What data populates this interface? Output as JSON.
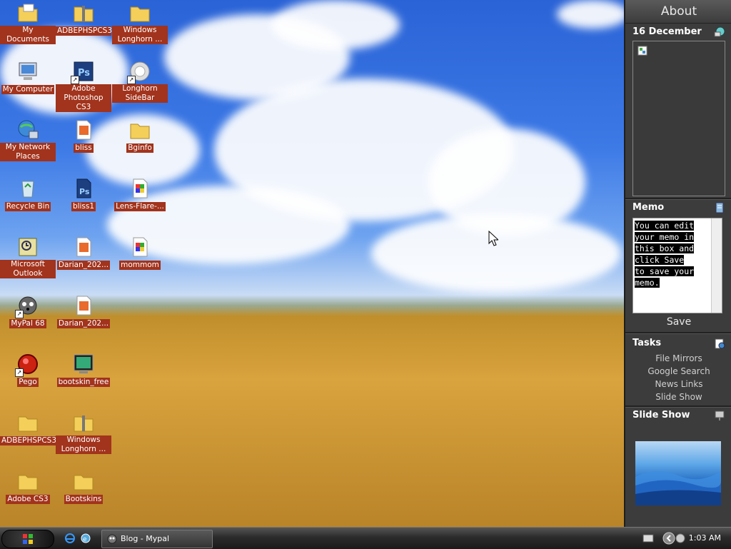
{
  "desktop": {
    "icons": [
      {
        "label": "My Documents",
        "icon": "folder-icon"
      },
      {
        "label": "ADBEPHSPCS3",
        "icon": "zip-folder-icon"
      },
      {
        "label": "Windows Longhorn ...",
        "icon": "folder-icon"
      },
      {
        "label": "My Computer",
        "icon": "computer-icon"
      },
      {
        "label": "Adobe Photoshop CS3",
        "icon": "photoshop-icon"
      },
      {
        "label": "Longhorn SideBar",
        "icon": "sidebar-icon"
      },
      {
        "label": "My Network Places",
        "icon": "network-icon"
      },
      {
        "label": "bliss",
        "icon": "image-file-icon"
      },
      {
        "label": "Bginfo",
        "icon": "folder-icon"
      },
      {
        "label": "Recycle Bin",
        "icon": "recycle-bin-icon"
      },
      {
        "label": "bliss1",
        "icon": "psd-file-icon"
      },
      {
        "label": "Lens-Flare-...",
        "icon": "image-file-icon"
      },
      {
        "label": "Microsoft Outlook",
        "icon": "outlook-icon"
      },
      {
        "label": "Darian_202...",
        "icon": "image-file-icon"
      },
      {
        "label": "mommom",
        "icon": "image-file-icon"
      },
      {
        "label": "MyPal 68",
        "icon": "mypal-icon"
      },
      {
        "label": "Darian_202...",
        "icon": "image-file-icon"
      },
      {
        "label": "Pego",
        "icon": "pego-icon"
      },
      {
        "label": "bootskin_free",
        "icon": "bootskin-icon"
      },
      {
        "label": "ADBEPHSPCS3",
        "icon": "folder-icon"
      },
      {
        "label": "Windows Longhorn ...",
        "icon": "zip-folder-icon"
      },
      {
        "label": "Adobe CS3",
        "icon": "folder-icon"
      },
      {
        "label": "Bootskins",
        "icon": "folder-icon"
      }
    ]
  },
  "sidebar": {
    "header": "About",
    "calendar": {
      "date": "16 December"
    },
    "memo": {
      "title": "Memo",
      "text": "You can edit\nyour memo in\nthis box and\nclick Save\nto save your\nmemo.",
      "save_label": "Save"
    },
    "tasks": {
      "title": "Tasks",
      "items": [
        "File Mirrors",
        "Google Search",
        "News Links",
        "Slide Show"
      ]
    },
    "slideshow": {
      "title": "Slide Show"
    }
  },
  "taskbar": {
    "window_button": "Blog - Mypal",
    "clock": "1:03 AM"
  },
  "colors": {
    "label_bg": "#a2331c",
    "sidebar_bg": "#3c3c3c"
  }
}
